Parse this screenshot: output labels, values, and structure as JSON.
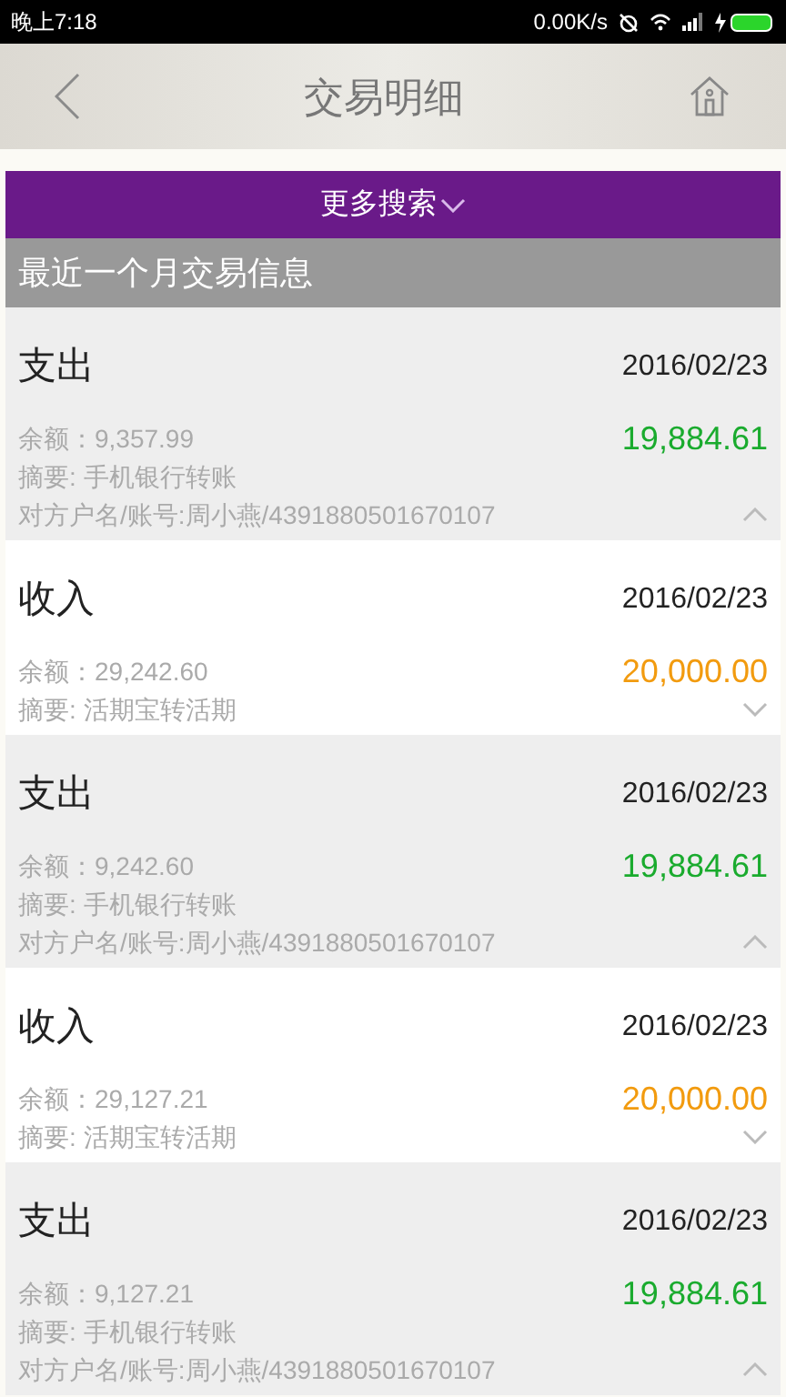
{
  "status_bar": {
    "time": "晚上7:18",
    "speed": "0.00K/s"
  },
  "header": {
    "title": "交易明细"
  },
  "search_bar": {
    "label": "更多搜索"
  },
  "section": {
    "title": "最近一个月交易信息"
  },
  "transactions": [
    {
      "kind": "expense",
      "type": "支出",
      "date": "2016/02/23",
      "balance": "余额：9,357.99",
      "amount": "19,884.61",
      "summary": "摘要: 手机银行转账",
      "counterparty": "对方户名/账号:周小燕/4391880501670107",
      "expanded": true
    },
    {
      "kind": "income",
      "type": "收入",
      "date": "2016/02/23",
      "balance": "余额：29,242.60",
      "amount": "20,000.00",
      "summary": "摘要: 活期宝转活期",
      "expanded": false
    },
    {
      "kind": "expense",
      "type": "支出",
      "date": "2016/02/23",
      "balance": "余额：9,242.60",
      "amount": "19,884.61",
      "summary": "摘要: 手机银行转账",
      "counterparty": "对方户名/账号:周小燕/4391880501670107",
      "expanded": true
    },
    {
      "kind": "income",
      "type": "收入",
      "date": "2016/02/23",
      "balance": "余额：29,127.21",
      "amount": "20,000.00",
      "summary": "摘要: 活期宝转活期",
      "expanded": false
    },
    {
      "kind": "expense",
      "type": "支出",
      "date": "2016/02/23",
      "balance": "余额：9,127.21",
      "amount": "19,884.61",
      "summary": "摘要: 手机银行转账",
      "counterparty": "对方户名/账号:周小燕/4391880501670107",
      "expanded": true
    }
  ]
}
